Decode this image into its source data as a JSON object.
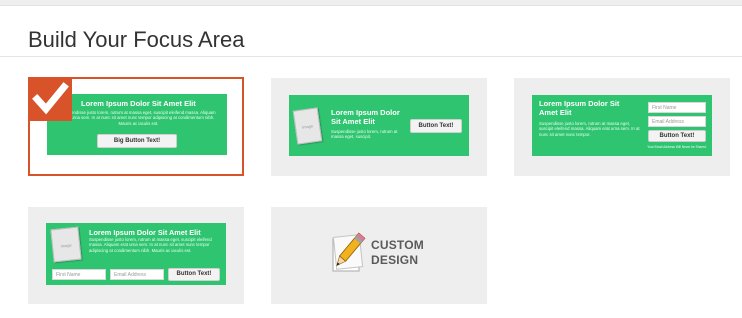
{
  "page": {
    "title": "Build Your Focus Area"
  },
  "colors": {
    "accent": "#d9532a",
    "green": "#2fc470",
    "card_bg": "#eeeeee"
  },
  "options": [
    {
      "title": "Lorem Ipsum Dolor Sit Amet Elit",
      "body": "Suspendisse justo lorem, rutrum at massa eget, suscipit eleifend massa. Aliquam erat urna sem. In at nunc sit amet nunc tempor adipiscing at condimentum nibh. Mauris ac iaculis est.",
      "button": "Big Button Text!",
      "selected": true,
      "badge_icon": "checkmark-icon"
    },
    {
      "title": "Lorem Ipsum Dolor Sit Amet Elit",
      "body": "Suspendisse justo lorem, rutrum at massa eget, suscipit.",
      "button": "Button Text!",
      "image_label": "Image",
      "selected": false
    },
    {
      "title": "Lorem Ipsum Dolor Sit Amet Elit",
      "body": "Suspendisse justo lorem, rutrum at massa eget, suscipit eleifend massa. Aliquam erat urna sem. In at nunc sit amet nunc tempor.",
      "first_name_placeholder": "First Name",
      "email_placeholder": "Email Address",
      "button": "Button Text!",
      "footnote": "Your Email Address Will Never be Shared.",
      "selected": false
    },
    {
      "title": "Lorem Ipsum Dolor Sit Amet Elit",
      "body": "Suspendisse justo lorem, rutrum at massa eget, suscipit eleifend massa. Aliquam erat urna sem. In at nunc sit amet nunc tempor adipiscing at condimentum nibh. Mauris ac iaculis est.",
      "image_label": "Image",
      "first_name_placeholder": "First Name",
      "email_placeholder": "Email Address",
      "button": "Button Text!",
      "selected": false
    },
    {
      "custom_line1": "CUSTOM",
      "custom_line2": "DESIGN",
      "icon": "pencil-paper-icon",
      "selected": false
    }
  ]
}
